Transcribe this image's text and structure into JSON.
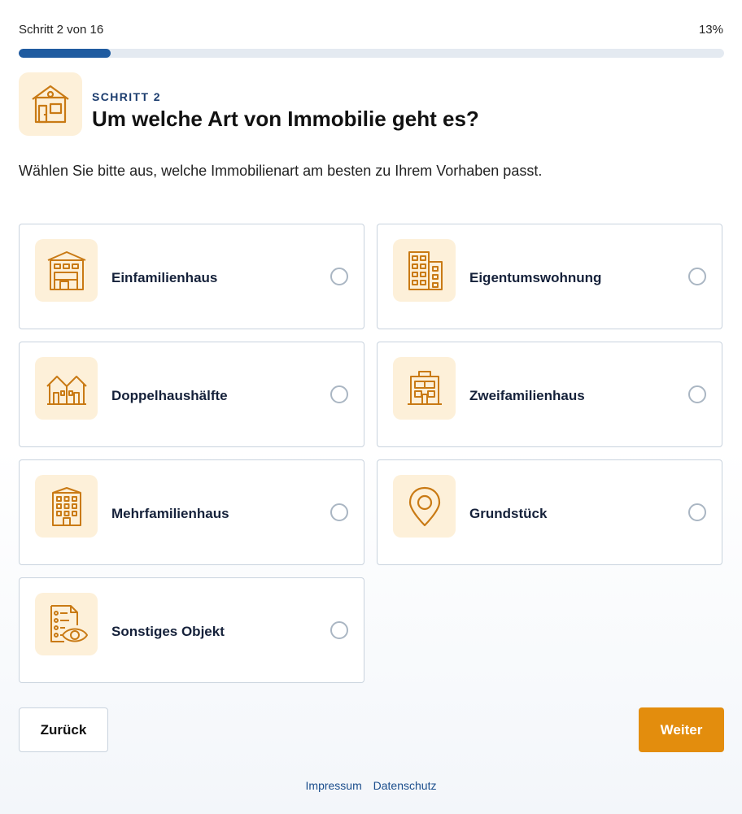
{
  "progress": {
    "step_text": "Schritt 2 von 16",
    "percent_text": "13%",
    "fraction": 0.13
  },
  "header": {
    "kicker": "SCHRITT 2",
    "title": "Um welche Art von Immobilie geht es?"
  },
  "subtitle": "Wählen Sie bitte aus, welche Immobilienart am besten zu Ihrem Vorhaben passt.",
  "options": [
    {
      "label": "Einfamilienhaus",
      "icon": "detached-house-icon",
      "selected": false
    },
    {
      "label": "Eigentumswohnung",
      "icon": "apartment-building-icon",
      "selected": false
    },
    {
      "label": "Doppelhaushälfte",
      "icon": "semi-detached-house-icon",
      "selected": false
    },
    {
      "label": "Zweifamilienhaus",
      "icon": "two-family-house-icon",
      "selected": false
    },
    {
      "label": "Mehrfamilienhaus",
      "icon": "multi-family-house-icon",
      "selected": false
    },
    {
      "label": "Grundstück",
      "icon": "map-pin-icon",
      "selected": false
    },
    {
      "label": "Sonstiges Objekt",
      "icon": "document-eye-icon",
      "selected": false
    }
  ],
  "buttons": {
    "back": "Zurück",
    "next": "Weiter"
  },
  "footer": {
    "impressum": "Impressum",
    "datenschutz": "Datenschutz"
  },
  "colors": {
    "accent": "#e38d0d",
    "progress": "#1f5ba0",
    "icon_stroke": "#c97a14",
    "icon_bg": "#fdf0d9"
  }
}
